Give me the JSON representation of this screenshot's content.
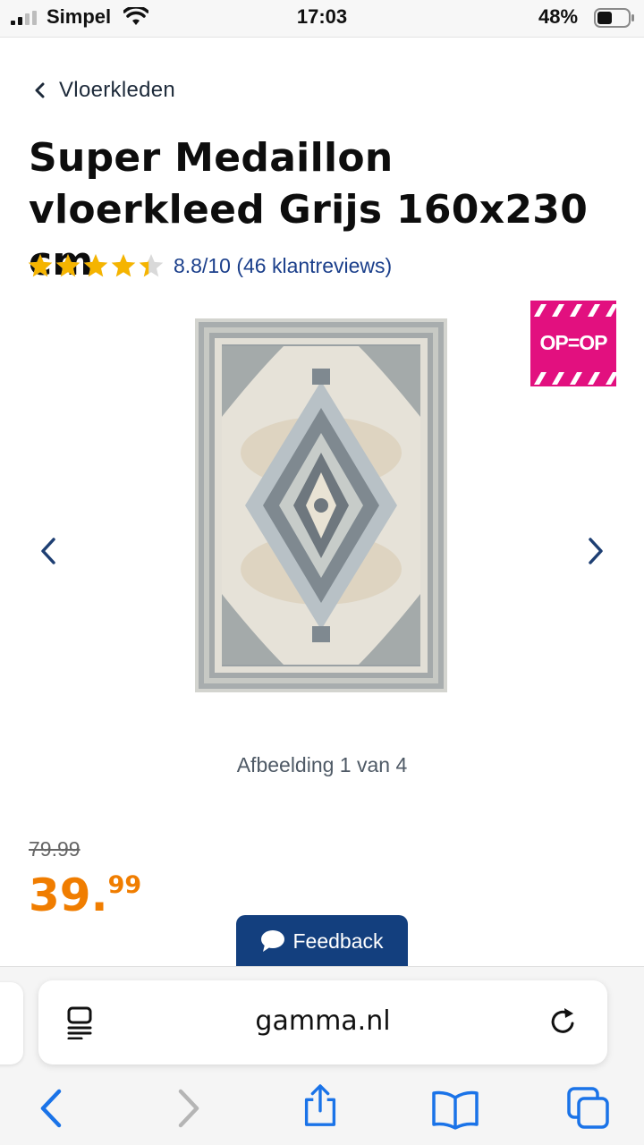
{
  "status_bar": {
    "carrier": "Simpel",
    "time": "17:03",
    "battery": "48%",
    "battery_fraction": 0.48
  },
  "breadcrumb": {
    "label": "Vloerkleden"
  },
  "product": {
    "title": "Super Medaillon vloerkleed Grijs 160x230 cm",
    "rating_stars": 4.4,
    "rating_text": "8.8/10 (46 klantreviews)",
    "badge": "OP=OP",
    "image_counter": "Afbeelding 1 van 4",
    "old_price": "79.99",
    "price_int": "39.",
    "price_dec": "99"
  },
  "feedback": {
    "label": "Feedback"
  },
  "browser": {
    "url": "gamma.nl"
  },
  "colors": {
    "accent_blue": "#133f7e",
    "link_blue": "#1b3f8b",
    "price_orange": "#f07d00",
    "star_yellow": "#f5b400",
    "badge_pink": "#e2107f",
    "ios_blue": "#1a73e8"
  },
  "icons": [
    "signal-icon",
    "wifi-icon",
    "battery-icon",
    "chevron-left-icon",
    "star-icon",
    "chevron-right-icon",
    "speech-bubble-icon",
    "reader-icon",
    "reload-icon",
    "back-icon",
    "forward-icon",
    "share-icon",
    "bookmarks-icon",
    "tabs-icon"
  ]
}
